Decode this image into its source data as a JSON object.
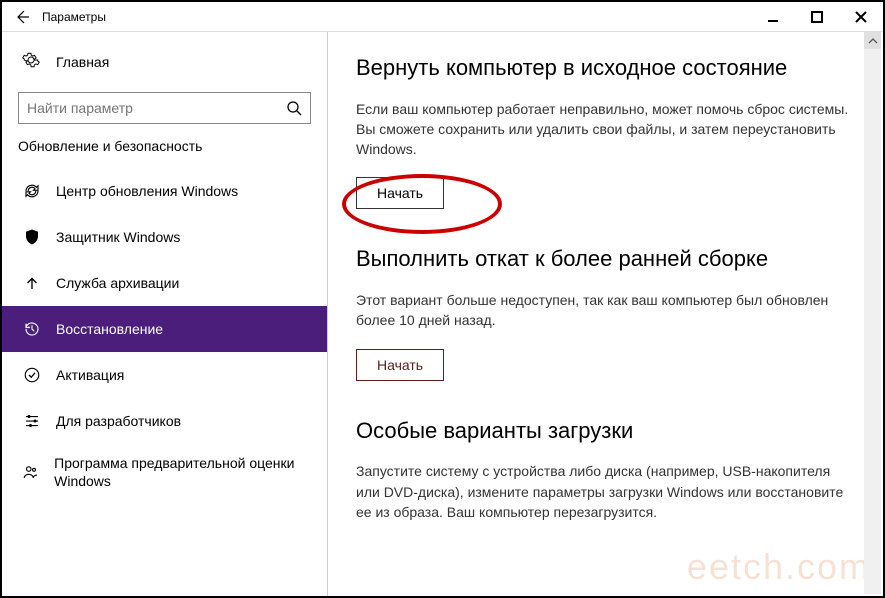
{
  "titlebar": {
    "title": "Параметры"
  },
  "home": {
    "label": "Главная"
  },
  "search": {
    "placeholder": "Найти параметр"
  },
  "category": "Обновление и безопасность",
  "nav": [
    {
      "label": "Центр обновления Windows"
    },
    {
      "label": "Защитник Windows"
    },
    {
      "label": "Служба архивации"
    },
    {
      "label": "Восстановление"
    },
    {
      "label": "Активация"
    },
    {
      "label": "Для разработчиков"
    },
    {
      "label": "Программа предварительной оценки Windows"
    }
  ],
  "sections": {
    "reset": {
      "title": "Вернуть компьютер в исходное состояние",
      "desc": "Если ваш компьютер работает неправильно, может помочь сброс системы. Вы сможете сохранить или удалить свои файлы, и затем переустановить Windows.",
      "button": "Начать"
    },
    "rollback": {
      "title": "Выполнить откат к более ранней сборке",
      "desc": "Этот вариант больше недоступен, так как ваш компьютер был обновлен более 10 дней назад.",
      "button": "Начать"
    },
    "boot": {
      "title": "Особые варианты загрузки",
      "desc": "Запустите систему с устройства либо диска (например, USB-накопителя или DVD-диска), измените параметры загрузки Windows или восстановите ее из образа. Ваш компьютер перезагрузится."
    }
  },
  "watermark": "eetch.com"
}
